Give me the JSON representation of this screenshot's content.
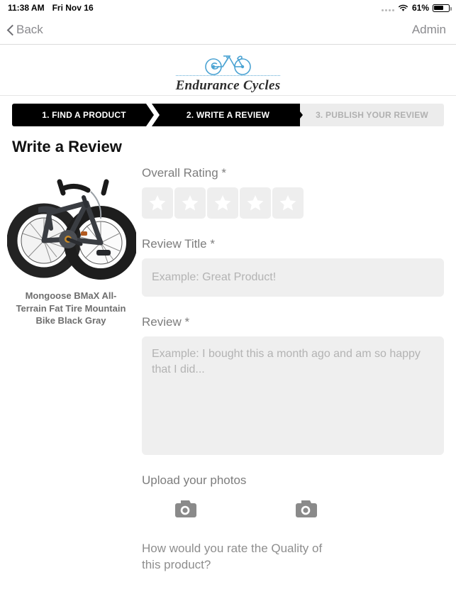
{
  "status_bar": {
    "time": "11:38 AM",
    "date": "Fri Nov 16",
    "battery_percent": "61%",
    "wifi_icon": "wifi-icon",
    "battery_icon": "battery-icon",
    "signal_icon": "signal-dots-icon"
  },
  "nav": {
    "back_label": "Back",
    "back_icon": "chevron-left-icon",
    "right_label": "Admin"
  },
  "brand": {
    "name": "Endurance Cycles",
    "logo_icon": "bicycle-icon",
    "accent_color": "#5ba8d4"
  },
  "steps": [
    {
      "label": "1. FIND A PRODUCT",
      "state": "done"
    },
    {
      "label": "2. WRITE A REVIEW",
      "state": "active"
    },
    {
      "label": "3. PUBLISH YOUR REVIEW",
      "state": "upcoming"
    }
  ],
  "page": {
    "title": "Write a Review"
  },
  "product": {
    "name": "Mongoose BMaX All-Terrain Fat Tire Mountain Bike Black Gray",
    "image_alt": "black gray fat tire mountain bike"
  },
  "form": {
    "rating": {
      "label": "Overall Rating *",
      "stars_total": 5,
      "stars_selected": 0,
      "star_icon": "star-icon"
    },
    "title_field": {
      "label": "Review Title *",
      "value": "",
      "placeholder": "Example: Great Product!"
    },
    "review_field": {
      "label": "Review *",
      "value": "",
      "placeholder": "Example: I bought this a month ago and am so happy that I did..."
    },
    "upload": {
      "label": "Upload your photos",
      "slots": [
        {
          "icon": "camera-icon"
        },
        {
          "icon": "camera-icon"
        }
      ]
    },
    "quality_question": "How would you rate the Quality of this product?"
  },
  "colors": {
    "step_active": "#000000",
    "step_upcoming_bg": "#ececec",
    "step_upcoming_text": "#b0b0b0",
    "field_bg": "#efefef",
    "placeholder": "#b3b3b3",
    "label": "#7d7d7d"
  }
}
